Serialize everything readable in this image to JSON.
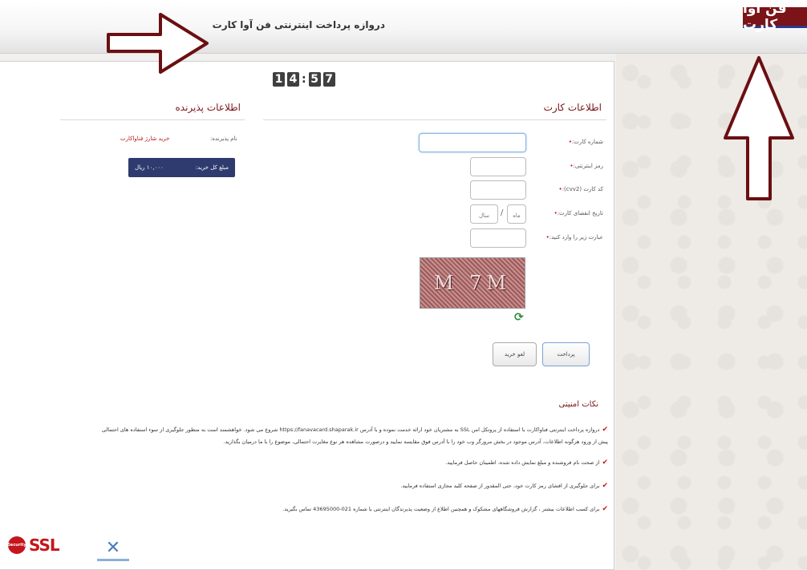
{
  "header": {
    "title": "دروازه پرداخت اینترنتی فن آوا کارت",
    "logo_text": "فن آوا کارت"
  },
  "timer": {
    "minutes_tens": "1",
    "minutes_ones": "4",
    "separator": ":",
    "seconds_tens": "5",
    "seconds_ones": "7"
  },
  "card_info": {
    "title": "اطلاعات کارت",
    "fields": {
      "card_number": {
        "label": "شماره کارت:",
        "value": ""
      },
      "internet_pin": {
        "label": "رمز اینترنتی:",
        "value": ""
      },
      "cvv2": {
        "label": "کد کارت (cvv2):",
        "value": ""
      },
      "expiry": {
        "label": "تاریخ انقضای کارت:",
        "month_placeholder": "ماه",
        "year_placeholder": "سال",
        "separator": "/"
      },
      "captcha": {
        "label": "عبارت زیر را وارد کنید:",
        "value": "",
        "image_text": "M 7M"
      }
    },
    "buttons": {
      "pay": "پرداخت",
      "cancel": "لغو خرید"
    }
  },
  "merchant_info": {
    "title": "اطلاعات پذیرنده",
    "merchant_label": "نام پذیرنده:",
    "merchant_value": "خرید شارژ فناواکارت",
    "amount_label": "مبلغ کل خرید:",
    "amount_value": "۱۰,۰۰۰ ریال"
  },
  "security_notes": {
    "title": "نکات امنیتی",
    "items": [
      "دروازه پرداخت اینترنتی فناواکارت با استفاده از پروتکل امن SSL به مشتریان خود ارائه خدمت نموده و با آدرس https://fanavacard.shaparak.ir شروع می شود. خواهشمند است به منظور جلوگیری از سوء استفاده های احتمالی",
      "پیش از ورود هرگونه اطلاعات، آدرس موجود در بخش مرورگر وب خود را با آدرس فوق مقایسه نمایید و درصورت مشاهده هر نوع مغایرت احتمالی، موضوع را با ما درمیان بگذارید.",
      "از صحت نام فروشنده و مبلغ نمایش داده شده، اطمینان حاصل فرمایید.",
      "برای جلوگیری از افشای رمز کارت خود، حتی المقدور از صفحه کلید مجازی استفاده فرمایید.",
      "برای کسب اطلاعات بیشتر ، گزارش فروشگاههای مشکوک و همچنین اطلاع از وضعیت پذیرندگان اینترنتی با شماره 021-43695000 تماس بگیرید."
    ]
  },
  "footer": {
    "ssl_text": "SSL",
    "ssl_badge_text": "Security"
  },
  "colors": {
    "accent": "#7a1418",
    "annotation_arrow": "#6b0f12",
    "amount_box": "#2f3b6e"
  }
}
